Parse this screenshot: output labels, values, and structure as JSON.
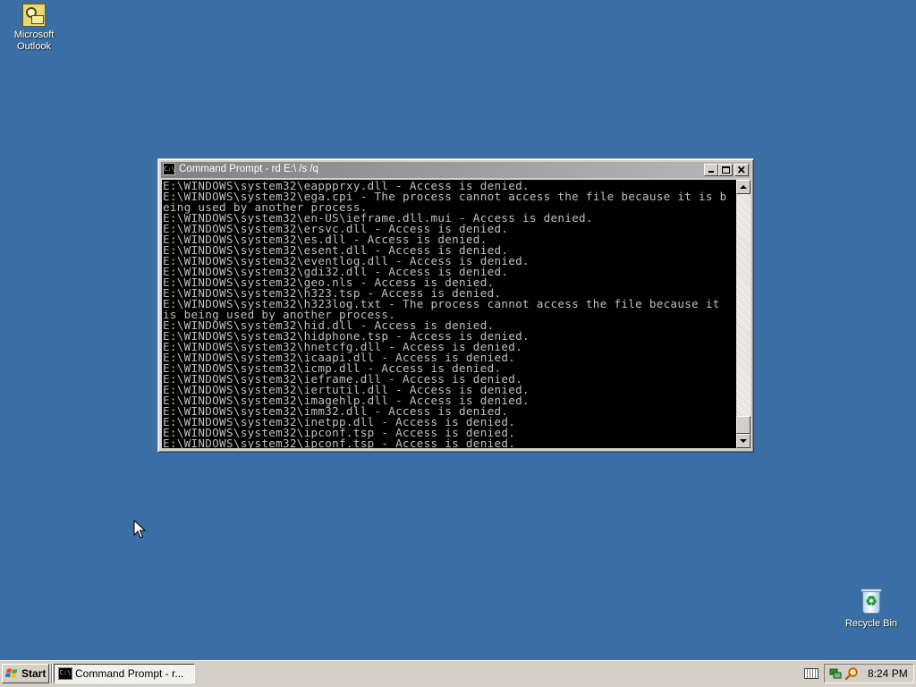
{
  "desktop": {
    "icons": [
      {
        "label_line1": "Microsoft",
        "label_line2": "Outlook",
        "icon": "outlook-icon"
      },
      {
        "label": "Recycle Bin",
        "icon": "recycle-bin-icon"
      }
    ],
    "background_color": "#3a6ea5"
  },
  "window": {
    "title": "Command Prompt - rd E:\\ /s /q",
    "title_icon_text": "C:\\",
    "buttons": [
      "minimize",
      "maximize",
      "close"
    ],
    "console_lines": [
      "E:\\WINDOWS\\system32\\eappprxy.dll - Access is denied.",
      "E:\\WINDOWS\\system32\\ega.cpi - The process cannot access the file because it is b",
      "eing used by another process.",
      "E:\\WINDOWS\\system32\\en-US\\ieframe.dll.mui - Access is denied.",
      "E:\\WINDOWS\\system32\\ersvc.dll - Access is denied.",
      "E:\\WINDOWS\\system32\\es.dll - Access is denied.",
      "E:\\WINDOWS\\system32\\esent.dll - Access is denied.",
      "E:\\WINDOWS\\system32\\eventlog.dll - Access is denied.",
      "E:\\WINDOWS\\system32\\gdi32.dll - Access is denied.",
      "E:\\WINDOWS\\system32\\geo.nls - Access is denied.",
      "E:\\WINDOWS\\system32\\h323.tsp - Access is denied.",
      "E:\\WINDOWS\\system32\\h323log.txt - The process cannot access the file because it",
      "is being used by another process.",
      "E:\\WINDOWS\\system32\\hid.dll - Access is denied.",
      "E:\\WINDOWS\\system32\\hidphone.tsp - Access is denied.",
      "E:\\WINDOWS\\system32\\hnetcfg.dll - Access is denied.",
      "E:\\WINDOWS\\system32\\icaapi.dll - Access is denied.",
      "E:\\WINDOWS\\system32\\icmp.dll - Access is denied.",
      "E:\\WINDOWS\\system32\\ieframe.dll - Access is denied.",
      "E:\\WINDOWS\\system32\\iertutil.dll - Access is denied.",
      "E:\\WINDOWS\\system32\\imagehlp.dll - Access is denied.",
      "E:\\WINDOWS\\system32\\imm32.dll - Access is denied.",
      "E:\\WINDOWS\\system32\\inetpp.dll - Access is denied.",
      "E:\\WINDOWS\\system32\\ipconf.tsp - Access is denied.",
      "E:\\WINDOWS\\system32\\ipconf.tsp - Access is denied."
    ]
  },
  "taskbar": {
    "start_label": "Start",
    "task_label": "Command Prompt - r...",
    "task_icon_text": "C:\\",
    "clock": "8:24 PM"
  }
}
